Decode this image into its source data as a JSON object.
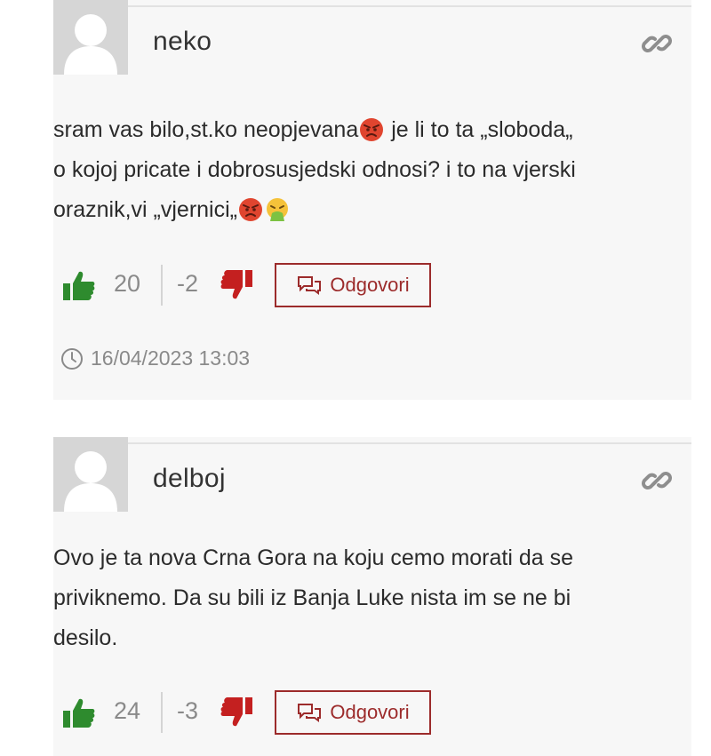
{
  "comments": [
    {
      "author": "neko",
      "lines": [
        "sram vas bilo,st.ko neopjevana",
        " je li to ta „sloboda„",
        "o kojoj pricate i dobrosusjedski odnosi? i to na vjerski",
        "oraznik,vi „vjernici„"
      ],
      "upvotes": "20",
      "downvotes": "-2",
      "reply_label": "Odgovori",
      "date": "16/04/2023 13:03"
    },
    {
      "author": "delboj",
      "lines": [
        "Ovo je ta nova Crna Gora na koju cemo morati da se",
        "priviknemo. Da su bili iz Banja Luke nista im se ne bi",
        "desilo."
      ],
      "upvotes": "24",
      "downvotes": "-3",
      "reply_label": "Odgovori"
    }
  ],
  "icons": {
    "avatar": "default-avatar-icon",
    "permalink": "link-icon",
    "upvote": "thumbs-up-icon",
    "downvote": "thumbs-down-icon",
    "reply": "speech-bubbles-icon",
    "date": "clock-icon",
    "emojis": [
      "angry-face-emoji",
      "angry-face-emoji",
      "vomiting-face-emoji"
    ]
  },
  "colors": {
    "accent": "#9c2b2b",
    "upvote": "#2e8b2e",
    "downvote": "#c42020",
    "card_bg": "#f7f7f7",
    "muted_text": "#8a8a8a"
  }
}
